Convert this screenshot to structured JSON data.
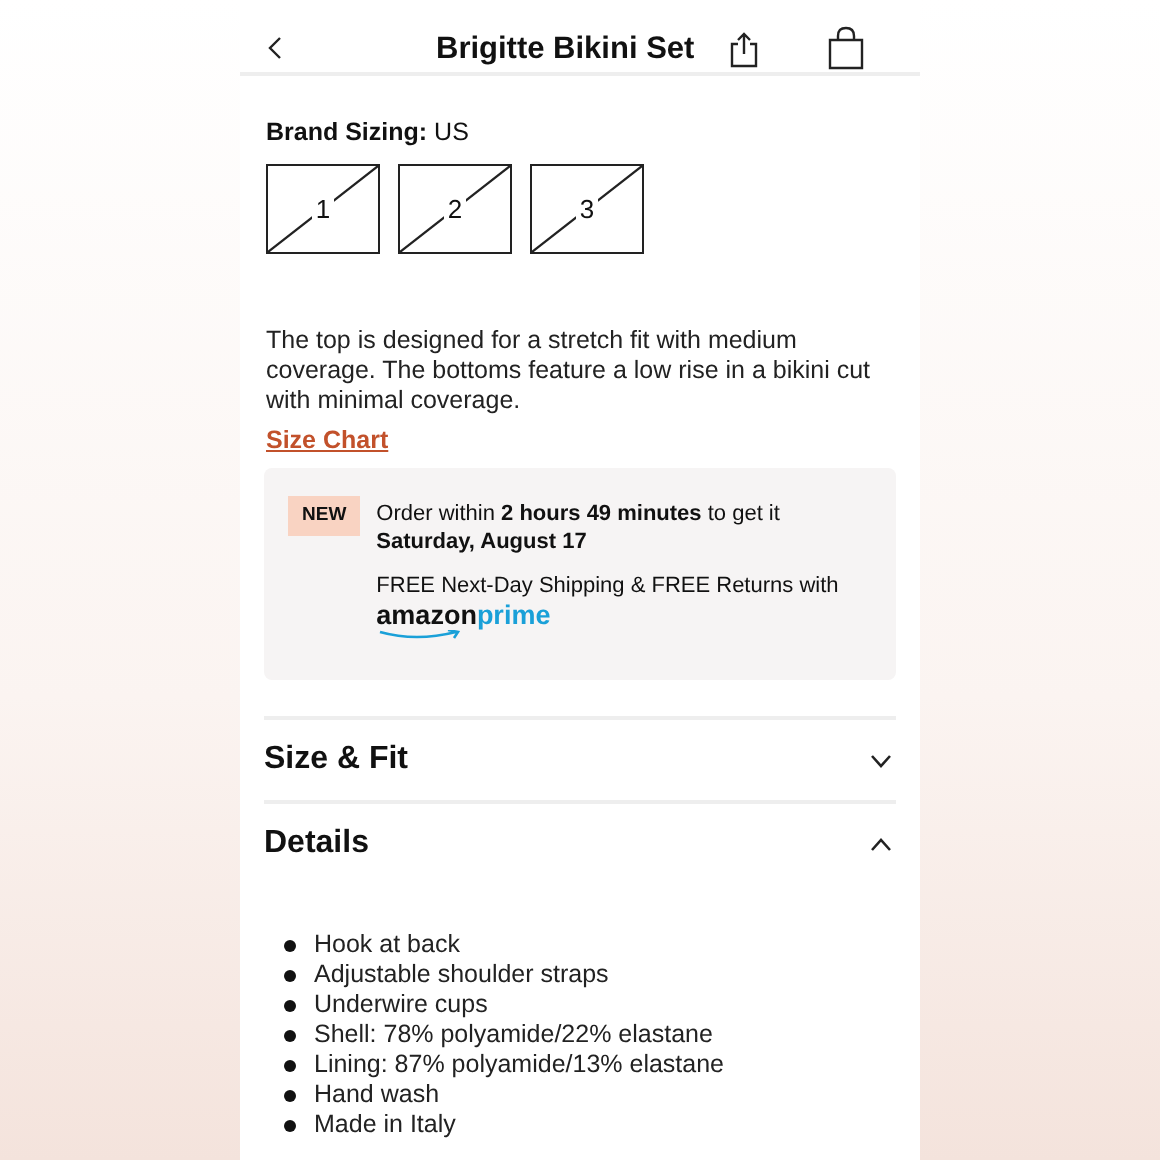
{
  "header": {
    "title": "Brigitte Bikini Set"
  },
  "brand_sizing": {
    "label": "Brand Sizing:",
    "value": "US"
  },
  "sizes": [
    {
      "label": "1",
      "available": false
    },
    {
      "label": "2",
      "available": false
    },
    {
      "label": "3",
      "available": false
    }
  ],
  "description": "The top is designed for a stretch fit with medium coverage. The bottoms feature a low rise in a bikini cut with minimal coverage.",
  "size_chart_link": "Size Chart",
  "delivery": {
    "badge": "NEW",
    "message": "Order within **2 hours 49 minutes** to get it **Saturday, August 17**",
    "shipping": "FREE Next-Day Shipping & FREE Returns with",
    "logo": {
      "brand": "amazon",
      "tier": "prime"
    }
  },
  "sections": [
    {
      "title": "Size & Fit",
      "expanded": false
    },
    {
      "title": "Details",
      "expanded": true,
      "items": [
        "Hook at back",
        "Adjustable shoulder straps",
        "Underwire cups",
        "Shell: 78% polyamide/22% elastane",
        "Lining: 87% polyamide/13% elastane",
        "Hand wash",
        "Made in Italy"
      ]
    }
  ]
}
